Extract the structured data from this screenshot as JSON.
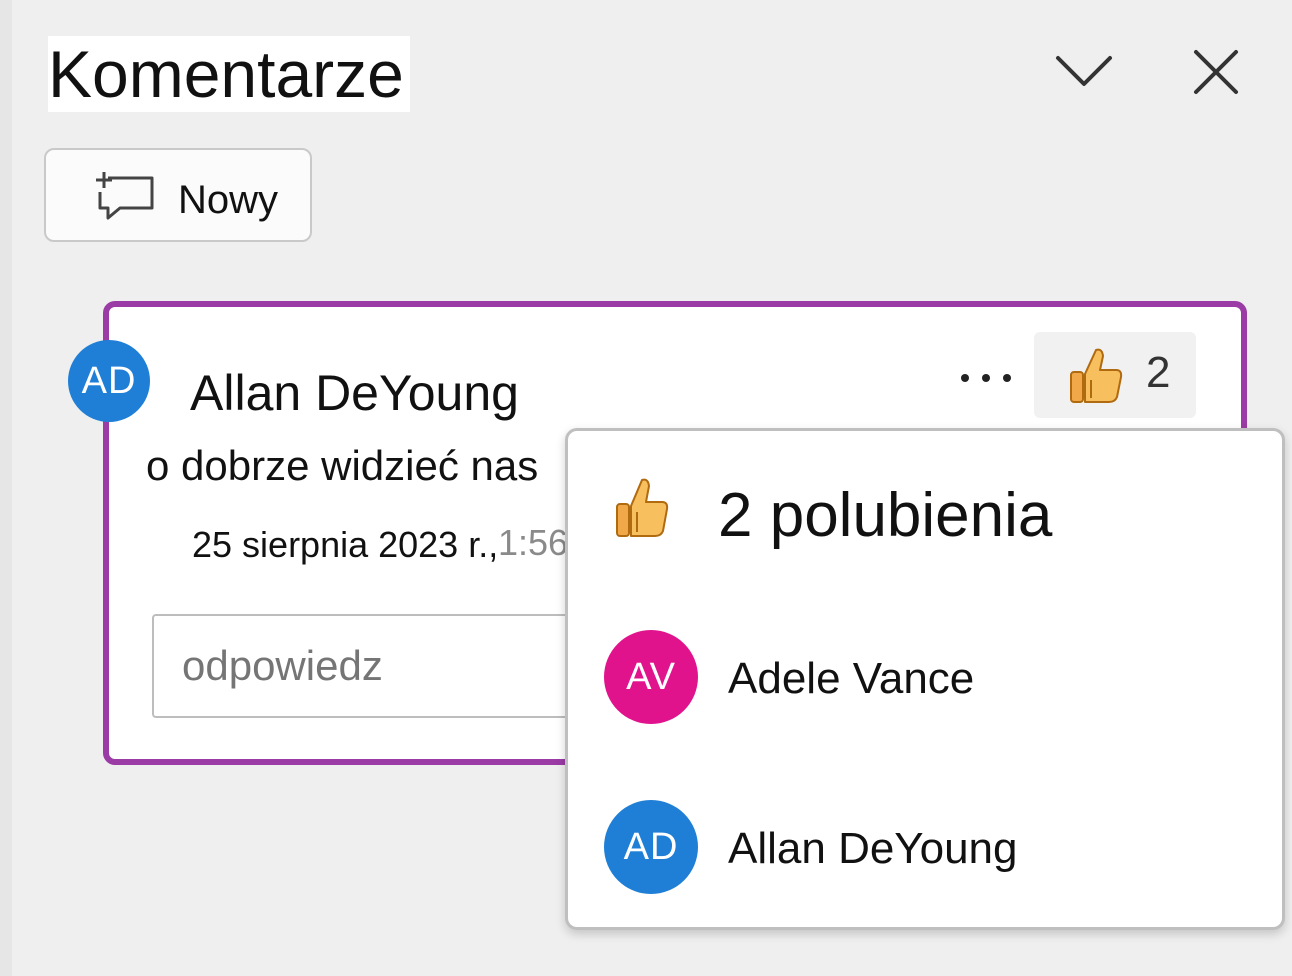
{
  "header": {
    "title": "Komentarze",
    "collapse_icon": "chevron-down-icon",
    "close_icon": "close-icon"
  },
  "toolbar": {
    "new_label": "Nowy",
    "new_icon": "new-comment-icon"
  },
  "comment": {
    "author_initials": "AD",
    "author_name": "Allan DeYoung",
    "text": "o dobrze widzieć nas",
    "date": "25 sierpnia 2023 r.,",
    "time_fragment": "1:56",
    "more_icon": "more-options-icon",
    "like_icon": "thumbs-up-icon",
    "like_count": "2",
    "reply_placeholder": "odpowiedz"
  },
  "likes_popup": {
    "title": "2 polubienia",
    "icon": "thumbs-up-icon",
    "likers": [
      {
        "initials": "AV",
        "name": "Adele Vance",
        "color": "#e0138c"
      },
      {
        "initials": "AD",
        "name": "Allan DeYoung",
        "color": "#1f7fd6"
      }
    ]
  },
  "colors": {
    "card_border": "#9b3ba5",
    "avatar_blue": "#1f7fd6",
    "avatar_pink": "#e0138c",
    "thumb_fill": "#f0a848"
  }
}
